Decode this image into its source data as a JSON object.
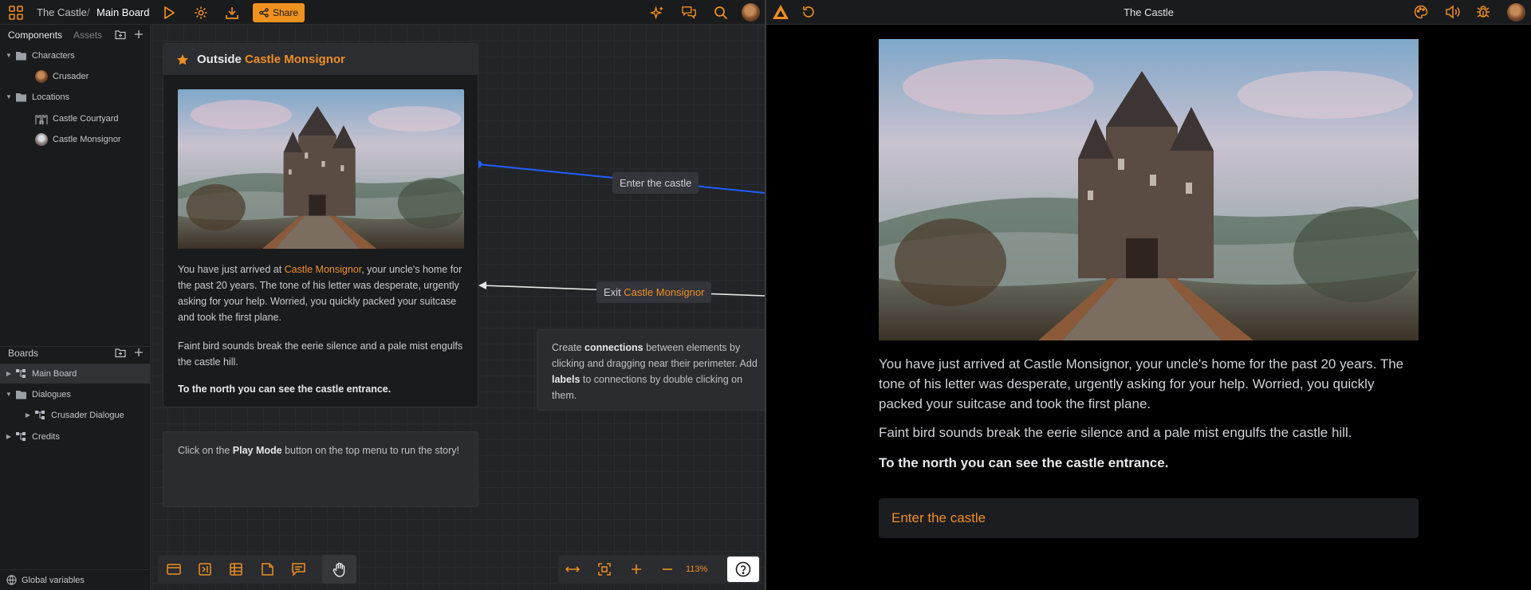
{
  "topbar": {
    "project": "The Castle",
    "separator": "/",
    "board": "Main Board",
    "share_label": "Share"
  },
  "sidebar": {
    "tab_components": "Components",
    "tab_assets": "Assets",
    "components": [
      {
        "label": "Characters",
        "icon": "folder-icon"
      },
      {
        "label": "Crusader",
        "icon": "avatar"
      },
      {
        "label": "Locations",
        "icon": "folder-icon"
      },
      {
        "label": "Castle Courtyard",
        "icon": "castle-icon"
      },
      {
        "label": "Castle Monsignor",
        "icon": "avatar"
      }
    ],
    "boards_title": "Boards",
    "boards": [
      {
        "label": "Main Board",
        "icon": "board-icon",
        "selected": true
      },
      {
        "label": "Dialogues",
        "icon": "folder-icon"
      },
      {
        "label": "Crusader Dialogue",
        "icon": "board-icon"
      },
      {
        "label": "Credits",
        "icon": "board-icon"
      }
    ],
    "global_variables": "Global variables"
  },
  "node": {
    "title_prefix": "Outside",
    "title_link": "Castle Monsignor",
    "p1_before": "You have just arrived at ",
    "p1_link": "Castle Monsignor",
    "p1_after": ", your uncle's home for the past 20 years. The tone of his letter was desperate, urgently asking for your help. Worried, you quickly packed your suitcase and took the first plane.",
    "p2": "Faint bird sounds break the eerie silence and a pale mist engulfs the castle hill.",
    "p3": "To the north you can see the castle entrance."
  },
  "connections": {
    "enter_label": "Enter the castle",
    "exit_prefix": "Exit",
    "exit_link": "Castle Monsignor"
  },
  "hints": {
    "play_before": "Click on the ",
    "play_bold": "Play Mode",
    "play_after": " button on the top menu to run the story!",
    "conn_1": "Create ",
    "conn_bold1": "connections",
    "conn_2": " between elements by clicking and dragging near their perimeter. Add ",
    "conn_bold2": "labels",
    "conn_3": " to connections by double clicking on them."
  },
  "canvas_toolbar": {
    "zoom": "113%"
  },
  "player": {
    "title": "The Castle",
    "p1": "You have just arrived at Castle Monsignor, your uncle's home for the past 20 years. The tone of his letter was desperate, urgently asking for your help. Worried, you quickly packed your suitcase and took the first plane.",
    "p2": "Faint bird sounds break the eerie silence and a pale mist engulfs the castle hill.",
    "p3": "To the north you can see the castle entrance.",
    "choice": "Enter the castle"
  },
  "colors": {
    "accent": "#ee8e24",
    "connection_blue": "#1f5fff",
    "background": "#1d1e20"
  }
}
